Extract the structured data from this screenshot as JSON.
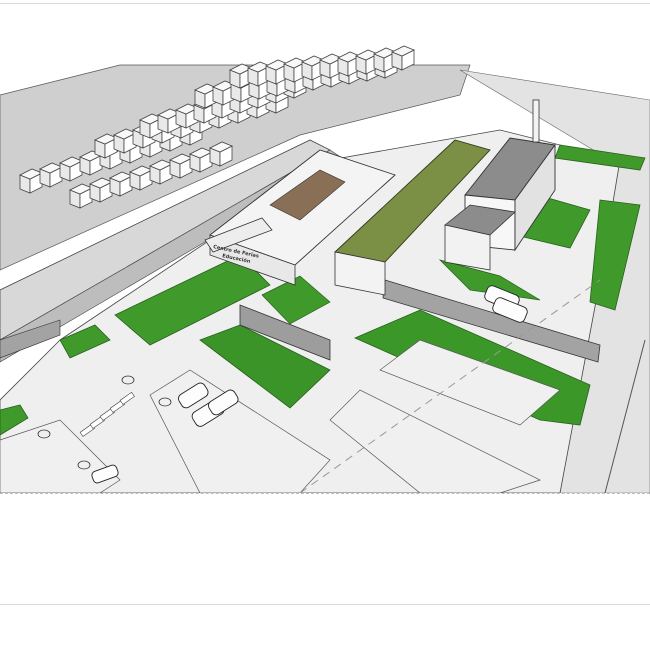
{
  "colors": {
    "ground": "#c9c9c9",
    "road": "#d6d6d6",
    "pavement": "#ececec",
    "lawn": "#3f9a2b",
    "lawn_dark": "#2f7d20",
    "green_roof": "#6f8a3a",
    "wall": "#9a9a9a",
    "building_white": "#f6f6f6",
    "roof_gravel": "#8c8c8c",
    "outline": "#333333"
  },
  "building": {
    "sign_line1": "Centro de Ferias",
    "sign_line2": "Educación"
  }
}
